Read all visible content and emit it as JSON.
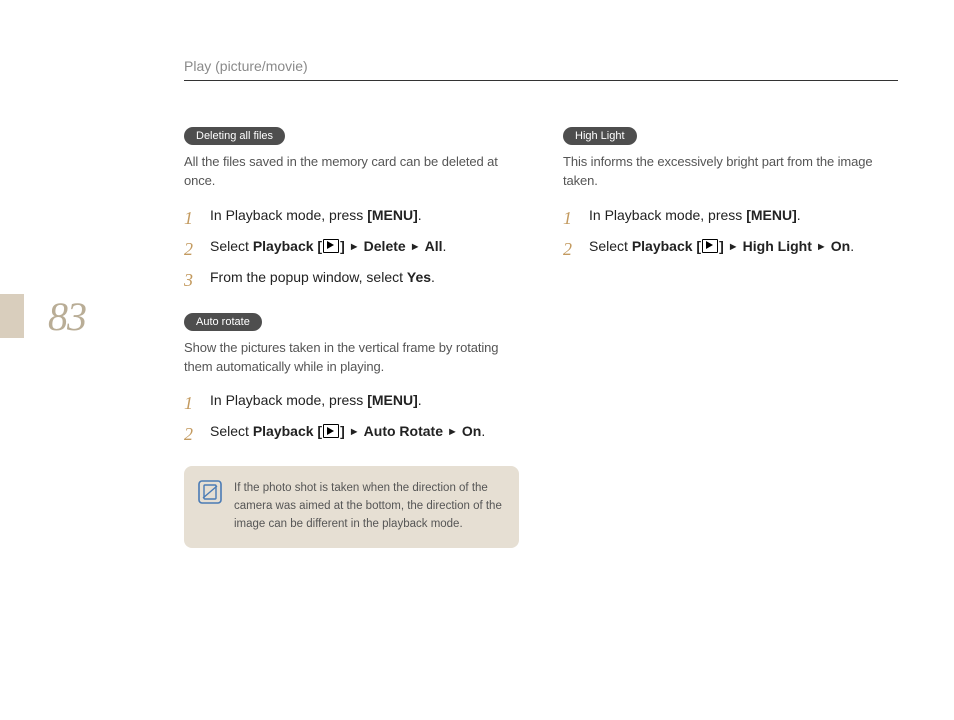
{
  "header": "Play (picture/movie)",
  "page_number": "83",
  "left": {
    "sec1": {
      "title": "Deleting all files",
      "desc": "All the files saved in the memory card can be deleted at once.",
      "steps": {
        "s1_pre": "In Playback mode, press ",
        "s1_menu": "[MENU]",
        "s2_pre": "Select ",
        "s2_pb": "Playback",
        "s2_b1": "Delete",
        "s2_b2": "All",
        "s3_pre": "From the popup window, select ",
        "s3_b": "Yes"
      }
    },
    "sec2": {
      "title": "Auto rotate",
      "desc": "Show the pictures taken in the vertical frame by rotating them automatically while in playing.",
      "steps": {
        "s1_pre": "In Playback mode, press ",
        "s1_menu": "[MENU]",
        "s2_pre": "Select ",
        "s2_pb": "Playback",
        "s2_b1": "Auto Rotate",
        "s2_b2": "On"
      },
      "note": "If the photo shot is taken when the direction of the camera was aimed at the bottom, the direction of the image can be different in the playback mode."
    }
  },
  "right": {
    "sec1": {
      "title": "High Light",
      "desc": "This informs the excessively bright part from the image taken.",
      "steps": {
        "s1_pre": "In Playback mode, press ",
        "s1_menu": "[MENU]",
        "s2_pre": "Select ",
        "s2_pb": "Playback",
        "s2_b1": "High Light",
        "s2_b2": "On"
      }
    }
  }
}
